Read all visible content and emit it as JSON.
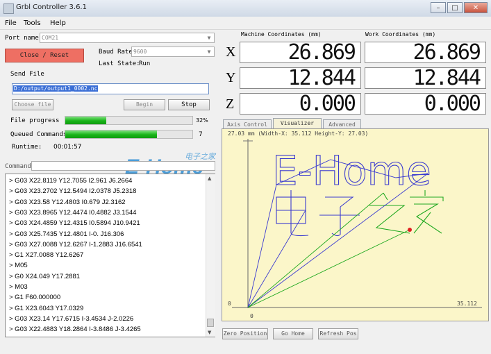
{
  "window": {
    "title": "Grbl Controller 3.6.1"
  },
  "menu": [
    "File",
    "Tools",
    "Help"
  ],
  "connection": {
    "port_label": "Port name",
    "port_value": "COM21",
    "connect_button": "Close / Reset",
    "baud_label": "Baud Rate",
    "baud_value": "9600",
    "state_label": "Last State:",
    "state_value": "Run"
  },
  "send": {
    "section_label": "Send File",
    "file_path": "D:/output/output1_0002.nc",
    "choose_button": "Choose file",
    "begin_button": "Begin",
    "stop_button": "Stop",
    "progress_label": "File progress",
    "progress_percent": 32,
    "progress_text": "32%",
    "queued_label": "Queued Commands",
    "queued_value": "7",
    "queued_fill": 0.72,
    "runtime_label": "Runtime:",
    "runtime_value": "00:01:57"
  },
  "command": {
    "label": "Command",
    "value": ""
  },
  "console_lines": [
    "> G03 X22.8119 Y12.7055 I2.961 J6.2664",
    "> G03 X23.2702 Y12.5494 I2.0378 J5.2318",
    "> G03 X23.58 Y12.4803 I0.679 J2.3162",
    "> G03 X23.8965 Y12.4474 I0.4882 J3.1544",
    "> G03 X24.4859 Y12.4315 I0.5894 J10.9421",
    "> G03 X25.7435 Y12.4801 I-0. J16.306",
    "> G03 X27.0088 Y12.6267 I-1.2883 J16.6541",
    "> G1  X27.0088 Y12.6267",
    "> M05",
    "> G0 X24.049 Y17.2881",
    "> M03",
    "> G1 F60.000000",
    "> G1  X23.6043 Y17.0329",
    "> G03 X23.14 Y17.6715 I-3.4534 J-2.0226",
    "> G03 X22.4883 Y18.2864 I-3.8486 J-3.4265"
  ],
  "coords": {
    "machine_label": "Machine Coordinates (mm)",
    "work_label": "Work Coordinates  (mm)",
    "axes": [
      {
        "name": "X",
        "machine": "26.869",
        "work": "26.869"
      },
      {
        "name": "Y",
        "machine": "12.844",
        "work": "12.844"
      },
      {
        "name": "Z",
        "machine": "0.000",
        "work": "0.000"
      }
    ]
  },
  "tabs": [
    {
      "label": "Axis Control",
      "active": false
    },
    {
      "label": "Visualizer",
      "active": true
    },
    {
      "label": "Advanced",
      "active": false
    }
  ],
  "visualizer": {
    "header": "27.03 mm  (Width-X: 35.112  Height-Y: 27.03)",
    "origin_left": "0",
    "origin_bottom": "0",
    "xmax_label": "35.112",
    "path_color": "#3a3ad0",
    "done_color": "#1fa81f",
    "pos_color": "#e02020"
  },
  "bottom_buttons": {
    "zero": "Zero Position",
    "home": "Go Home",
    "refresh": "Refresh Pos"
  },
  "watermark": {
    "text": "E-Home",
    "sub": "电子之家"
  }
}
